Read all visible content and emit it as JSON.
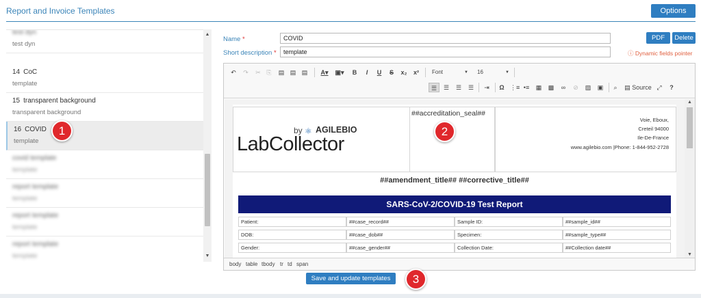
{
  "header": {
    "title": "Report and Invoice Templates",
    "options_label": "Options"
  },
  "sidebar": {
    "items": [
      {
        "num": "",
        "name": "test dyn",
        "desc": "test dyn",
        "blur_title": true
      },
      {
        "num": "14",
        "name": "CoC",
        "desc": "template"
      },
      {
        "num": "15",
        "name": "transparent background",
        "desc": "transparent background"
      },
      {
        "num": "16",
        "name": "COVID",
        "desc": "template",
        "active": true
      },
      {
        "num": "",
        "name": "covid template",
        "desc": "template",
        "blurred": true
      },
      {
        "num": "",
        "name": "report template",
        "desc": "template",
        "blurred": true
      },
      {
        "num": "",
        "name": "report template",
        "desc": "template",
        "blurred": true
      },
      {
        "num": "",
        "name": "report template",
        "desc": "template",
        "blurred": true
      }
    ]
  },
  "form": {
    "name_label": "Name",
    "name_value": "COVID",
    "short_desc_label": "Short description",
    "short_desc_value": "template",
    "required_mark": "*",
    "pdf_label": "PDF",
    "delete_label": "Delete",
    "dynamic_fields_label": "ⓘ Dynamic fields pointer"
  },
  "toolbar": {
    "font_label": "Font",
    "size_label": "16",
    "source_label": "Source"
  },
  "document": {
    "logo_by": "by",
    "logo_brand": "AGILEBIO",
    "logo_name": "LabCollector",
    "accreditation": "##accreditation_seal##",
    "address": [
      "Voie, Eboux,",
      "Creteil 94000",
      "Ile-De-France",
      "www.agilebio.com  |Phone: 1-844-952-2728"
    ],
    "amendment": "##amendment_title## ##corrective_title##",
    "report_title": "SARS-CoV-2/COVID-19 Test Report",
    "rows": [
      [
        "Patient:",
        "##case_record##",
        "Sample ID:",
        "##sample_id##"
      ],
      [
        "DOB:",
        "##case_dob##",
        "Specimen:",
        "##sample_type##"
      ],
      [
        "Gender:",
        "##case_gender##",
        "Collection Date:",
        "##Collection date##"
      ]
    ]
  },
  "pathbar": [
    "body",
    "table",
    "tbody",
    "tr",
    "td",
    "span"
  ],
  "save_label": "Save and update templates",
  "steps": [
    "1",
    "2",
    "3"
  ],
  "colors": {
    "accent": "#2f7ec1",
    "report_band": "#101a78",
    "step": "#e0282c"
  }
}
